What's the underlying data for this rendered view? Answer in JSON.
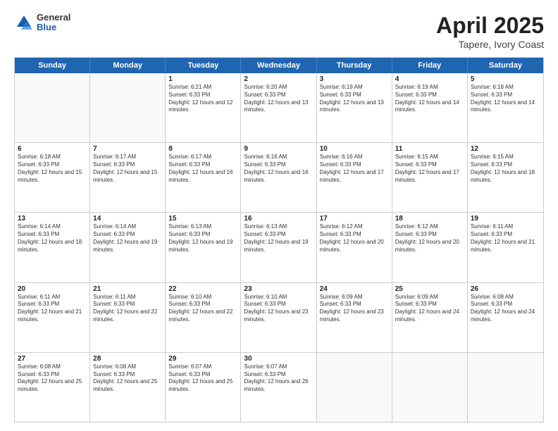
{
  "header": {
    "logo": {
      "line1": "General",
      "line2": "Blue"
    },
    "title": "April 2025",
    "subtitle": "Tapere, Ivory Coast"
  },
  "weekdays": [
    "Sunday",
    "Monday",
    "Tuesday",
    "Wednesday",
    "Thursday",
    "Friday",
    "Saturday"
  ],
  "weeks": [
    [
      {
        "day": "",
        "empty": true
      },
      {
        "day": "",
        "empty": true
      },
      {
        "day": "1",
        "sunrise": "6:21 AM",
        "sunset": "6:33 PM",
        "daylight": "12 hours and 12 minutes."
      },
      {
        "day": "2",
        "sunrise": "6:20 AM",
        "sunset": "6:33 PM",
        "daylight": "12 hours and 13 minutes."
      },
      {
        "day": "3",
        "sunrise": "6:19 AM",
        "sunset": "6:33 PM",
        "daylight": "12 hours and 13 minutes."
      },
      {
        "day": "4",
        "sunrise": "6:19 AM",
        "sunset": "6:33 PM",
        "daylight": "12 hours and 14 minutes."
      },
      {
        "day": "5",
        "sunrise": "6:18 AM",
        "sunset": "6:33 PM",
        "daylight": "12 hours and 14 minutes."
      }
    ],
    [
      {
        "day": "6",
        "sunrise": "6:18 AM",
        "sunset": "6:33 PM",
        "daylight": "12 hours and 15 minutes."
      },
      {
        "day": "7",
        "sunrise": "6:17 AM",
        "sunset": "6:33 PM",
        "daylight": "12 hours and 15 minutes."
      },
      {
        "day": "8",
        "sunrise": "6:17 AM",
        "sunset": "6:33 PM",
        "daylight": "12 hours and 16 minutes."
      },
      {
        "day": "9",
        "sunrise": "6:16 AM",
        "sunset": "6:33 PM",
        "daylight": "12 hours and 16 minutes."
      },
      {
        "day": "10",
        "sunrise": "6:16 AM",
        "sunset": "6:33 PM",
        "daylight": "12 hours and 17 minutes."
      },
      {
        "day": "11",
        "sunrise": "6:15 AM",
        "sunset": "6:33 PM",
        "daylight": "12 hours and 17 minutes."
      },
      {
        "day": "12",
        "sunrise": "6:15 AM",
        "sunset": "6:33 PM",
        "daylight": "12 hours and 18 minutes."
      }
    ],
    [
      {
        "day": "13",
        "sunrise": "6:14 AM",
        "sunset": "6:33 PM",
        "daylight": "12 hours and 18 minutes."
      },
      {
        "day": "14",
        "sunrise": "6:14 AM",
        "sunset": "6:33 PM",
        "daylight": "12 hours and 19 minutes."
      },
      {
        "day": "15",
        "sunrise": "6:13 AM",
        "sunset": "6:33 PM",
        "daylight": "12 hours and 19 minutes."
      },
      {
        "day": "16",
        "sunrise": "6:13 AM",
        "sunset": "6:33 PM",
        "daylight": "12 hours and 19 minutes."
      },
      {
        "day": "17",
        "sunrise": "6:12 AM",
        "sunset": "6:33 PM",
        "daylight": "12 hours and 20 minutes."
      },
      {
        "day": "18",
        "sunrise": "6:12 AM",
        "sunset": "6:33 PM",
        "daylight": "12 hours and 20 minutes."
      },
      {
        "day": "19",
        "sunrise": "6:11 AM",
        "sunset": "6:33 PM",
        "daylight": "12 hours and 21 minutes."
      }
    ],
    [
      {
        "day": "20",
        "sunrise": "6:11 AM",
        "sunset": "6:33 PM",
        "daylight": "12 hours and 21 minutes."
      },
      {
        "day": "21",
        "sunrise": "6:11 AM",
        "sunset": "6:33 PM",
        "daylight": "12 hours and 22 minutes."
      },
      {
        "day": "22",
        "sunrise": "6:10 AM",
        "sunset": "6:33 PM",
        "daylight": "12 hours and 22 minutes."
      },
      {
        "day": "23",
        "sunrise": "6:10 AM",
        "sunset": "6:33 PM",
        "daylight": "12 hours and 23 minutes."
      },
      {
        "day": "24",
        "sunrise": "6:09 AM",
        "sunset": "6:33 PM",
        "daylight": "12 hours and 23 minutes."
      },
      {
        "day": "25",
        "sunrise": "6:09 AM",
        "sunset": "6:33 PM",
        "daylight": "12 hours and 24 minutes."
      },
      {
        "day": "26",
        "sunrise": "6:08 AM",
        "sunset": "6:33 PM",
        "daylight": "12 hours and 24 minutes."
      }
    ],
    [
      {
        "day": "27",
        "sunrise": "6:08 AM",
        "sunset": "6:33 PM",
        "daylight": "12 hours and 25 minutes."
      },
      {
        "day": "28",
        "sunrise": "6:08 AM",
        "sunset": "6:33 PM",
        "daylight": "12 hours and 25 minutes."
      },
      {
        "day": "29",
        "sunrise": "6:07 AM",
        "sunset": "6:33 PM",
        "daylight": "12 hours and 25 minutes."
      },
      {
        "day": "30",
        "sunrise": "6:07 AM",
        "sunset": "6:33 PM",
        "daylight": "12 hours and 26 minutes."
      },
      {
        "day": "",
        "empty": true
      },
      {
        "day": "",
        "empty": true
      },
      {
        "day": "",
        "empty": true
      }
    ]
  ]
}
